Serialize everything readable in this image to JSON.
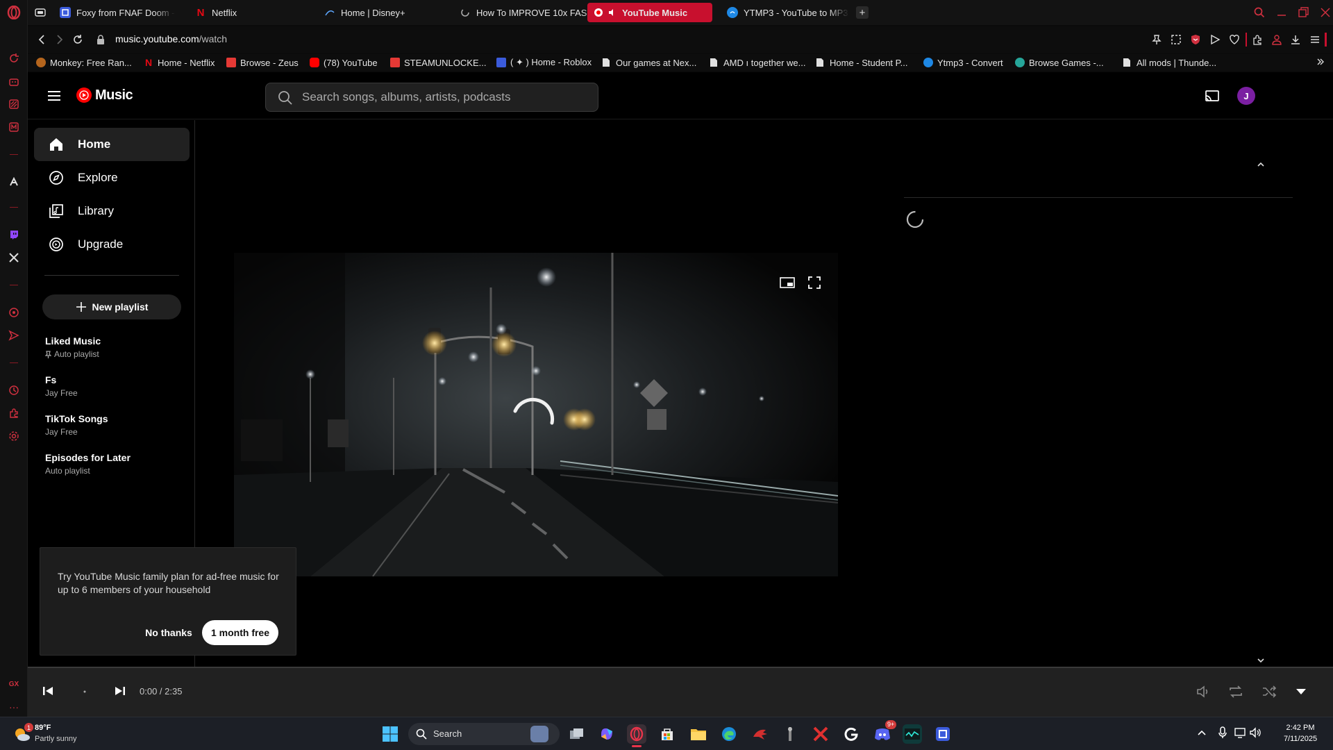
{
  "tabs": [
    {
      "label": "Foxy from FNAF Doom - R",
      "icon": "app-icon",
      "color": "#3b5bdb"
    },
    {
      "label": "Netflix",
      "icon": "netflix-icon",
      "color": "#e50914"
    },
    {
      "label": "Home | Disney+",
      "icon": "disney-icon",
      "color": "#1b74e4"
    },
    {
      "label": "How To IMPROVE 10x FAS",
      "icon": "loading-icon",
      "color": "#aaaaaa"
    },
    {
      "label": "YouTube Music",
      "icon": "youtube-music-icon",
      "color": "#ff0000"
    },
    {
      "label": "YTMP3 - YouTube to MP3",
      "icon": "ytmp3-icon",
      "color": "#1e88e5"
    }
  ],
  "address": {
    "host": "music.youtube.com",
    "path": "/watch"
  },
  "bookmarks": [
    {
      "label": "Monkey: Free Ran...",
      "color": "#b5651d"
    },
    {
      "label": "Home - Netflix",
      "color": "#e50914"
    },
    {
      "label": "Browse - Zeus",
      "color": "#e53935"
    },
    {
      "label": "(78) YouTube",
      "color": "#ff0000"
    },
    {
      "label": "STEAMUNLOCKE...",
      "color": "#e53935"
    },
    {
      "label": "( ✦ ) Home - Roblox",
      "color": "#3b5bdb"
    },
    {
      "label": "Our games at Nex...",
      "color": "#e0e0e0"
    },
    {
      "label": "AMD ı together we...",
      "color": "#e0e0e0"
    },
    {
      "label": "Home - Student P...",
      "color": "#e0e0e0"
    },
    {
      "label": "Ytmp3 - Convert",
      "color": "#1e88e5"
    },
    {
      "label": "Browse Games -...",
      "color": "#26a69a"
    },
    {
      "label": "All mods | Thunde...",
      "color": "#e0e0e0"
    }
  ],
  "app": {
    "logo_text": "Music",
    "search_placeholder": "Search songs, albums, artists, podcasts",
    "avatar_letter": "J"
  },
  "nav": [
    {
      "label": "Home",
      "icon": "home-icon"
    },
    {
      "label": "Explore",
      "icon": "compass-icon"
    },
    {
      "label": "Library",
      "icon": "library-icon"
    },
    {
      "label": "Upgrade",
      "icon": "upgrade-icon"
    }
  ],
  "new_playlist_label": "New playlist",
  "playlists": [
    {
      "title": "Liked Music",
      "subtitle": "Auto playlist",
      "pinned": true
    },
    {
      "title": "Fs",
      "subtitle": "Jay Free",
      "pinned": false
    },
    {
      "title": "TikTok Songs",
      "subtitle": "Jay Free",
      "pinned": false
    },
    {
      "title": "Episodes for Later",
      "subtitle": "Auto playlist",
      "pinned": false
    }
  ],
  "promo": {
    "text": "Try YouTube Music family plan for ad-free music for up to 6 members of your household",
    "no_label": "No thanks",
    "yes_label": "1 month free"
  },
  "player": {
    "time": "0:00 / 2:35",
    "progress": 0
  },
  "taskbar": {
    "weather_temp": "89°F",
    "weather_desc": "Partly sunny",
    "weather_badge": "1",
    "search_label": "Search",
    "discord_badge": "9+",
    "time": "2:42 PM",
    "date": "7/11/2025"
  },
  "colors": {
    "accent": "#c8102e",
    "yt_red": "#ff0000",
    "avatar": "#7b1fa2"
  }
}
